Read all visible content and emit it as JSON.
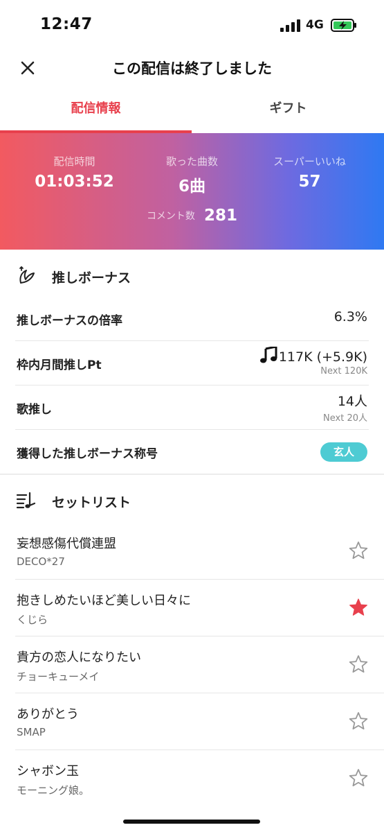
{
  "status_bar": {
    "time": "12:47",
    "network": "4G"
  },
  "header": {
    "title": "この配信は終了しました"
  },
  "tabs": [
    {
      "label": "配信情報",
      "active": true
    },
    {
      "label": "ギフト",
      "active": false
    }
  ],
  "stats": {
    "duration_label": "配信時間",
    "duration_value": "01:03:52",
    "songs_label": "歌った曲数",
    "songs_value": "6曲",
    "superlikes_label": "スーパーいいね",
    "superlikes_value": "57",
    "comments_label": "コメント数",
    "comments_value": "281"
  },
  "oshi_section": {
    "title": "推しボーナス",
    "rows": [
      {
        "label": "推しボーナスの倍率",
        "value": "6.3%"
      },
      {
        "label": "枠内月間推しPt",
        "value": "117K (+5.9K)",
        "sub": "Next 120K"
      },
      {
        "label": "歌推し",
        "value": "14人",
        "sub": "Next 20人"
      },
      {
        "label": "獲得した推しボーナス称号",
        "badge": "玄人"
      }
    ]
  },
  "setlist": {
    "title": "セットリスト",
    "songs": [
      {
        "title": "妄想感傷代償連盟",
        "artist": "DECO*27",
        "favorited": false
      },
      {
        "title": "抱きしめたいほど美しい日々に",
        "artist": "くじら",
        "favorited": true
      },
      {
        "title": "貴方の恋人になりたい",
        "artist": "チョーキューメイ",
        "favorited": false
      },
      {
        "title": "ありがとう",
        "artist": "SMAP",
        "favorited": false
      },
      {
        "title": "シャボン玉",
        "artist": "モーニング娘。",
        "favorited": false
      }
    ]
  },
  "colors": {
    "accent": "#e8404d",
    "badge": "#4ecbd3",
    "gradient_start": "#f25a60",
    "gradient_end": "#2f79f2"
  }
}
